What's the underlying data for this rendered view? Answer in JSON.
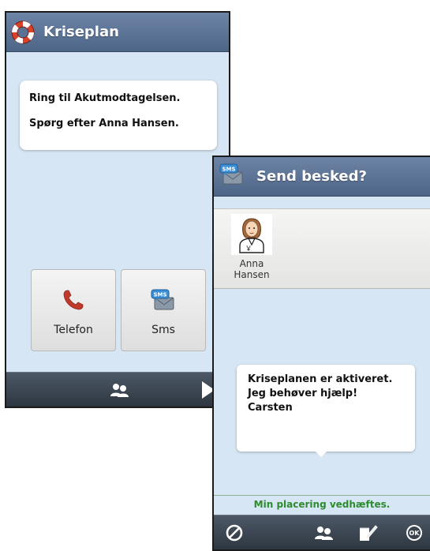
{
  "screen_a": {
    "title": "Kriseplan",
    "icon": "lifebuoy-icon",
    "message_lines": [
      "Ring til Akutmodtagelsen.",
      "Spørg efter Anna Hansen."
    ],
    "buttons": [
      {
        "label": "Telefon",
        "icon": "phone-icon"
      },
      {
        "label": "Sms",
        "icon": "sms-icon"
      }
    ],
    "bottom_bar": {
      "icons": [
        "contacts-icon",
        "next-arrow-icon"
      ]
    }
  },
  "screen_b": {
    "title": "Send besked?",
    "icon": "sms-icon",
    "contact": {
      "name": "Anna Hansen",
      "icon": "nurse-avatar-icon"
    },
    "message": "Kriseplanen er aktiveret.\nJeg behøver hjælp!\nCarsten",
    "location_note": "Min placering vedhæftes.",
    "bottom_bar": {
      "icons": [
        "cancel-icon",
        "contacts-icon",
        "edit-note-icon",
        "ok-icon"
      ]
    }
  },
  "colors": {
    "titlebar": "#5a7194",
    "screen_background": "#d6e6f4",
    "bottombar": "#3a444f",
    "location_note_text": "#2e8b2e",
    "phone_icon": "#c0392b",
    "lifebuoy_red": "#d9412b"
  }
}
